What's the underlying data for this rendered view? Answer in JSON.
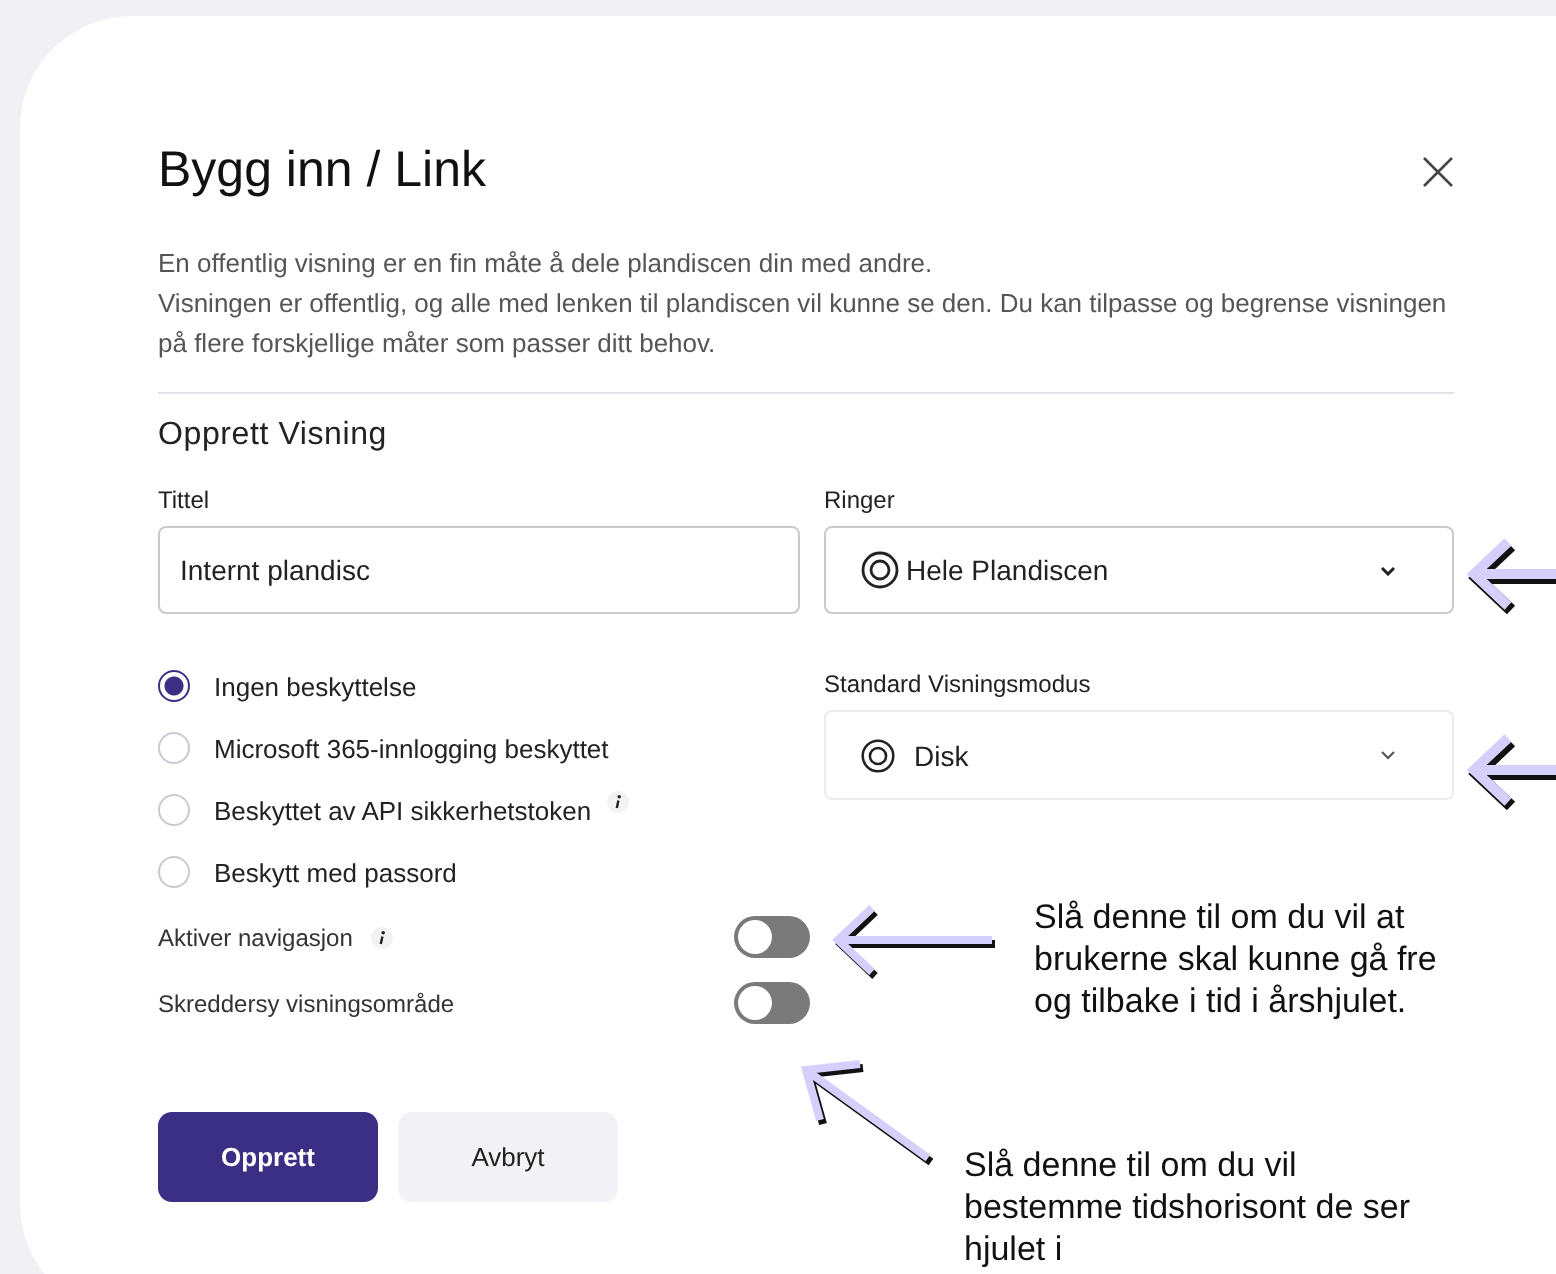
{
  "dialog": {
    "title": "Bygg inn / Link",
    "description": [
      "En offentlig visning er en fin måte å dele plandiscen din med andre.",
      "Visningen er offentlig, og alle med lenken til plandiscen vil kunne se den. Du kan tilpasse og begrense visningen på flere forskjellige måter som passer ditt behov."
    ],
    "section_title": "Opprett Visning",
    "title_field": {
      "label": "Tittel",
      "value": "Internt plandisc"
    },
    "rings_select": {
      "label": "Ringer",
      "value": "Hele Plandiscen"
    },
    "mode_select": {
      "label": "Standard Visningsmodus",
      "value": "Disk"
    },
    "protection_options": [
      {
        "label": "Ingen beskyttelse",
        "selected": true,
        "info": false
      },
      {
        "label": "Microsoft 365-innlogging beskyttet",
        "selected": false,
        "info": false
      },
      {
        "label": "Beskyttet av API sikkerhetstoken",
        "selected": false,
        "info": true
      },
      {
        "label": "Beskytt med passord",
        "selected": false,
        "info": false
      }
    ],
    "toggles": [
      {
        "label": "Aktiver navigasjon",
        "on": false,
        "info": true
      },
      {
        "label": "Skreddersy visningsområde",
        "on": false,
        "info": false
      }
    ],
    "buttons": [
      {
        "label": "Opprett",
        "kind": "primary"
      },
      {
        "label": "Avbryt",
        "kind": "secondary"
      }
    ]
  },
  "annotations": [
    {
      "lines": [
        "Slå denne til om du vil at",
        "brukerne skal kunne gå fre",
        "og tilbake i tid i årshjulet."
      ]
    },
    {
      "lines": [
        "Slå denne til om du vil",
        "bestemme tidshorisont de ser",
        "hjulet i"
      ]
    }
  ]
}
